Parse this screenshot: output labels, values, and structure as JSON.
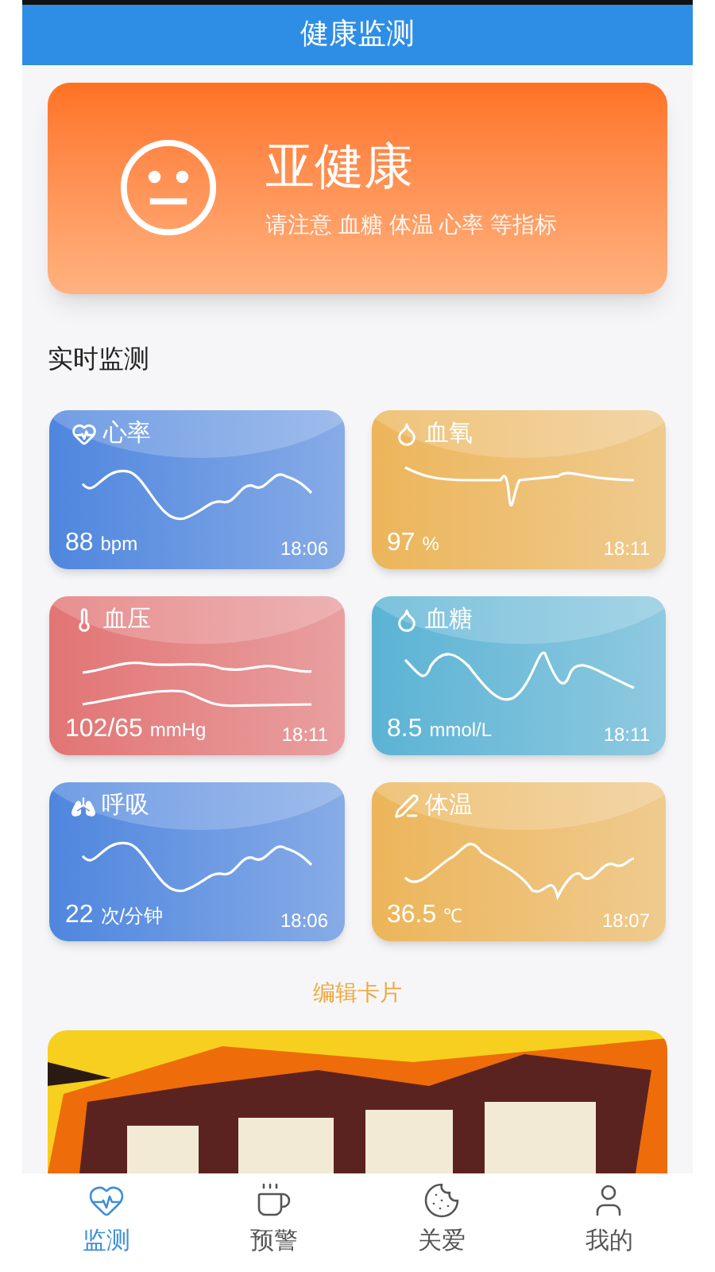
{
  "header": {
    "title": "健康监测"
  },
  "status": {
    "title": "亚健康",
    "subtitle": "请注意 血糖 体温 心率 等指标"
  },
  "section_title": "实时监测",
  "cards": [
    {
      "kind": "heart",
      "name": "心率",
      "value": "88",
      "unit": "bpm",
      "time": "18:06",
      "color": "#4f86de"
    },
    {
      "kind": "drop",
      "name": "血氧",
      "value": "97",
      "unit": "%",
      "time": "18:11",
      "color": "#ecb55a"
    },
    {
      "kind": "thermometer",
      "name": "血压",
      "value": "102/65",
      "unit": "mmHg",
      "time": "18:11",
      "color": "#e27474"
    },
    {
      "kind": "drop",
      "name": "血糖",
      "value": "8.5",
      "unit": "mmol/L",
      "time": "18:11",
      "color": "#5bb3d4"
    },
    {
      "kind": "lungs",
      "name": "呼吸",
      "value": "22",
      "unit": "次/分钟",
      "time": "18:06",
      "color": "#4f86de"
    },
    {
      "kind": "pen",
      "name": "体温",
      "value": "36.5",
      "unit": "℃",
      "time": "18:07",
      "color": "#ecb55a"
    }
  ],
  "edit_link": "编辑卡片",
  "tabs": [
    {
      "kind": "heart",
      "label": "监测",
      "selected": true
    },
    {
      "kind": "cup",
      "label": "预警",
      "selected": false
    },
    {
      "kind": "planet",
      "label": "关爱",
      "selected": false
    },
    {
      "kind": "user",
      "label": "我的",
      "selected": false
    }
  ]
}
